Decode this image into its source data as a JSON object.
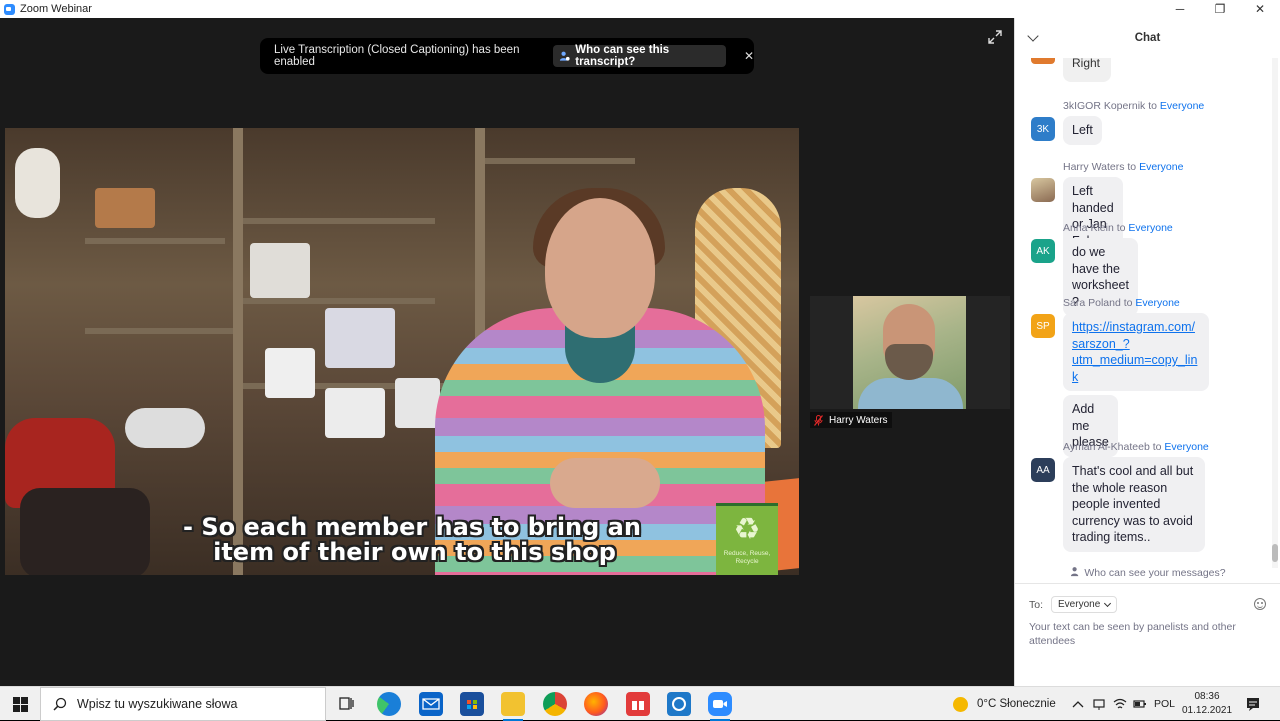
{
  "window": {
    "title": "Zoom Webinar",
    "controls": {
      "minimize": "─",
      "maximize": "❐",
      "close": "✕"
    }
  },
  "notice": {
    "message": "Live Transcription (Closed Captioning) has been enabled",
    "who_button": "Who can see this transcript?",
    "close": "✕"
  },
  "main_video": {
    "subtitle_line1": "- So each member has to bring an",
    "subtitle_line2": "item of their own to this shop",
    "badge_symbol": "♻",
    "badge_text": "Reduce, Reuse, Recycle"
  },
  "thumbnail": {
    "name": "Harry Waters",
    "muted": true
  },
  "chat": {
    "title": "Chat",
    "top_partial_text": "Right",
    "messages": [
      {
        "sender": "3kIGOR Kopernik",
        "to_word": "to",
        "to": "Everyone",
        "initials": "3K",
        "avatar_color": "#2e7dc9",
        "lines": [
          "Left"
        ]
      },
      {
        "sender": "Harry Waters",
        "to_word": "to",
        "to": "Everyone",
        "initials": "",
        "avatar_color": "#a07a5c",
        "lines": [
          "Left handed or Jan Feb"
        ]
      },
      {
        "sender": "Anna Klein",
        "to_word": "to",
        "to": "Everyone",
        "initials": "AK",
        "avatar_color": "#1aa38a",
        "lines": [
          "do we have the",
          "worksheet ?"
        ]
      },
      {
        "sender": "Sara Poland",
        "to_word": "to",
        "to": "Everyone",
        "initials": "SP",
        "avatar_color": "#f2a317",
        "link_lines": [
          "https://instagram.com/",
          "sarszon_?",
          "utm_medium=copy_lin",
          "k"
        ],
        "followup": "Add me please"
      },
      {
        "sender": "Ayman Al-Khateeb",
        "to_word": "to",
        "to": "Everyone",
        "initials": "AA",
        "avatar_color": "#2c3e5a",
        "lines": [
          "That's cool and all but",
          "the whole reason",
          "people invented",
          "currency was to avoid",
          "trading items.."
        ]
      }
    ],
    "who_can_see": "Who can see your messages?",
    "to_label": "To:",
    "to_value": "Everyone",
    "input_placeholder": "Your text can be seen by panelists and other attendees"
  },
  "taskbar": {
    "search_placeholder": "Wpisz tu wyszukiwane słowa",
    "weather": "0°C  Słonecznie",
    "language": "POL",
    "time": "08:36",
    "date": "01.12.2021",
    "apps": [
      "task-view",
      "edge",
      "mail",
      "store",
      "file-explorer",
      "chrome",
      "firefox",
      "gift",
      "app-blue",
      "zoom"
    ]
  },
  "colors": {
    "zoom_blue": "#2D8CFF",
    "link_blue": "#0e72ed",
    "stage_bg": "#1a1a1a"
  }
}
